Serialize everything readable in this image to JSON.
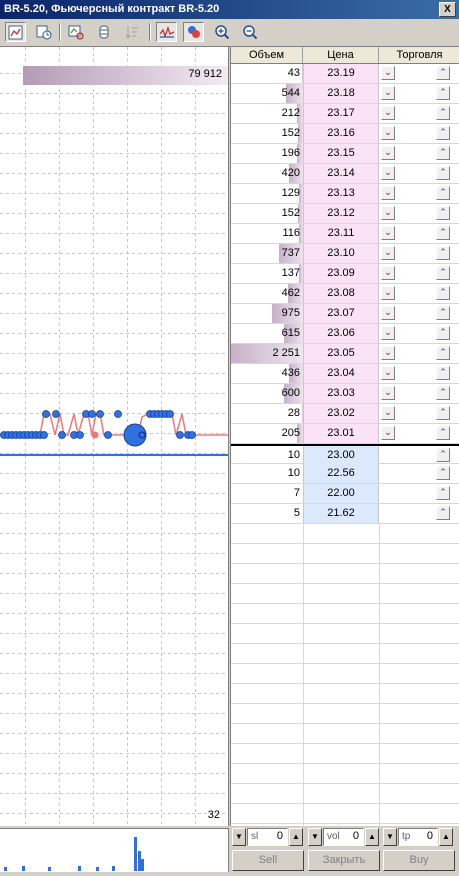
{
  "window": {
    "title": "BR-5.20, Фьючерсный контракт BR-5.20",
    "close_label": "X"
  },
  "toolbar": {
    "buttons": [
      {
        "name": "chart-settings-icon",
        "active": true
      },
      {
        "name": "clock-icon",
        "active": false
      },
      {
        "name": "refresh-chart-icon",
        "active": false
      },
      {
        "name": "cylinder-icon",
        "active": false
      },
      {
        "name": "sort-icon",
        "active": false
      },
      {
        "name": "line-chart-icon",
        "active": true
      },
      {
        "name": "ticks-icon",
        "active": true
      },
      {
        "name": "zoom-in-icon",
        "active": false
      },
      {
        "name": "zoom-out-icon",
        "active": false
      }
    ]
  },
  "chart": {
    "top_volume_label": "79 912",
    "bottom_count_label": "32"
  },
  "dom": {
    "headers": {
      "volume": "Объем",
      "price": "Цена",
      "trade": "Торговля"
    },
    "asks": [
      {
        "volume": "43",
        "price": "23.19",
        "bar": 0.02
      },
      {
        "volume": "544",
        "price": "23.18",
        "bar": 0.24
      },
      {
        "volume": "212",
        "price": "23.17",
        "bar": 0.09
      },
      {
        "volume": "152",
        "price": "23.16",
        "bar": 0.07
      },
      {
        "volume": "196",
        "price": "23.15",
        "bar": 0.09
      },
      {
        "volume": "420",
        "price": "23.14",
        "bar": 0.19
      },
      {
        "volume": "129",
        "price": "23.13",
        "bar": 0.06
      },
      {
        "volume": "152",
        "price": "23.12",
        "bar": 0.07
      },
      {
        "volume": "116",
        "price": "23.11",
        "bar": 0.05
      },
      {
        "volume": "737",
        "price": "23.10",
        "bar": 0.33
      },
      {
        "volume": "137",
        "price": "23.09",
        "bar": 0.06
      },
      {
        "volume": "462",
        "price": "23.08",
        "bar": 0.21
      },
      {
        "volume": "975",
        "price": "23.07",
        "bar": 0.43
      },
      {
        "volume": "615",
        "price": "23.06",
        "bar": 0.27
      },
      {
        "volume": "2 251",
        "price": "23.05",
        "bar": 1.0
      },
      {
        "volume": "436",
        "price": "23.04",
        "bar": 0.19
      },
      {
        "volume": "600",
        "price": "23.03",
        "bar": 0.27
      },
      {
        "volume": "28",
        "price": "23.02",
        "bar": 0.01
      },
      {
        "volume": "205",
        "price": "23.01",
        "bar": 0.09
      }
    ],
    "bids": [
      {
        "volume": "10",
        "price": "23.00"
      },
      {
        "volume": "10",
        "price": "22.56"
      },
      {
        "volume": "7",
        "price": "22.00"
      },
      {
        "volume": "5",
        "price": "21.62"
      }
    ],
    "sell_symbol": "⌄",
    "buy_symbol": "⌃"
  },
  "controls": {
    "sl": {
      "label": "sl",
      "value": "0"
    },
    "vol": {
      "label": "vol",
      "value": "0"
    },
    "tp": {
      "label": "tp",
      "value": "0"
    },
    "sell_button": "Sell",
    "close_button": "Закрыть",
    "buy_button": "Buy",
    "arrow_down": "▼",
    "arrow_up": "▲"
  },
  "colors": {
    "ask_bg": "#fbe3f7",
    "bid_bg": "#dce8fb",
    "ask_bar": "#c7b1c8",
    "sell": "#c00000",
    "buy": "#2040c0",
    "tick_red": "#f07878",
    "tick_blue": "#3070e0"
  }
}
